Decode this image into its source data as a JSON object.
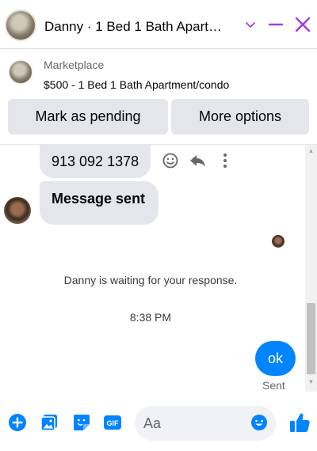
{
  "header": {
    "title": "Danny · 1 Bed 1 Bath Apart…"
  },
  "marketplace": {
    "label": "Marketplace",
    "listing": "$500 - 1 Bed 1 Bath Apartment/condo",
    "mark_pending_label": "Mark as pending",
    "more_options_label": "More options"
  },
  "messages": {
    "phone_text": "913 092 1378",
    "sent_text": "Message sent",
    "waiting_notice": "Danny is waiting for your response.",
    "timestamp": "8:38 PM",
    "outgoing_text": "ok",
    "outgoing_status": "Sent"
  },
  "composer": {
    "placeholder": "Aa",
    "gif_label": "GIF"
  },
  "colors": {
    "accent_purple": "#a23de6",
    "messenger_blue": "#0084ff",
    "bubble_gray": "#e4e6eb"
  }
}
